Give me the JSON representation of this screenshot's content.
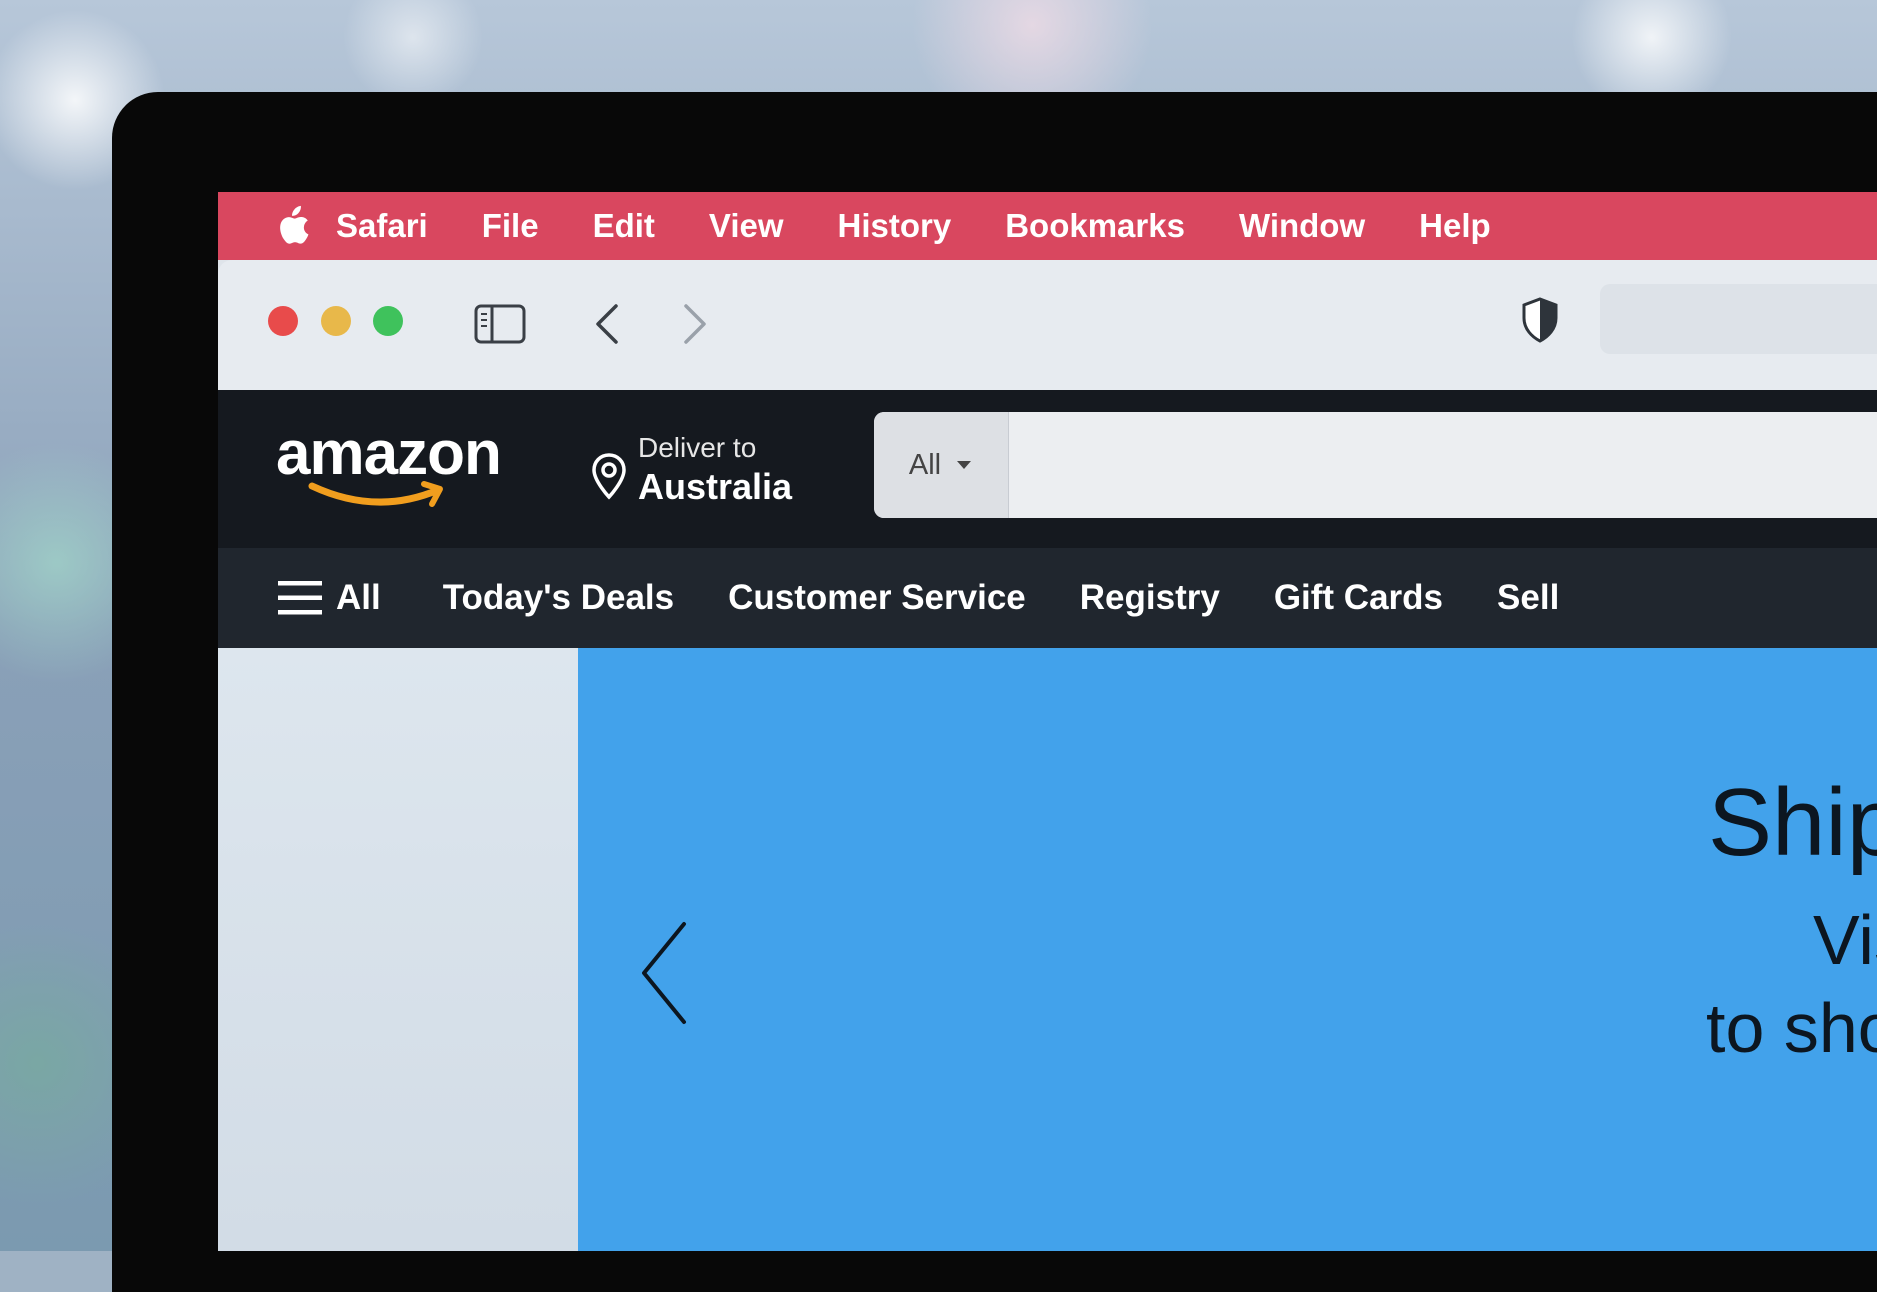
{
  "menubar": {
    "items": [
      "Safari",
      "File",
      "Edit",
      "View",
      "History",
      "Bookmarks",
      "Window",
      "Help"
    ]
  },
  "amazon": {
    "logo": "amazon",
    "deliver_label": "Deliver to",
    "deliver_location": "Australia",
    "search_category": "All",
    "search_placeholder": "",
    "nav": {
      "all_label": "All",
      "items": [
        "Today's Deals",
        "Customer Service",
        "Registry",
        "Gift Cards",
        "Sell"
      ]
    }
  },
  "hero": {
    "title": "Shipping",
    "line1": "Visit am",
    "line2": "to shop for"
  },
  "colors": {
    "menubar": "#d9475f",
    "amazon_header": "#15191f",
    "amazon_nav": "#20262e",
    "hero_background": "#42a2eb",
    "amazon_smile": "#f19e1e"
  }
}
